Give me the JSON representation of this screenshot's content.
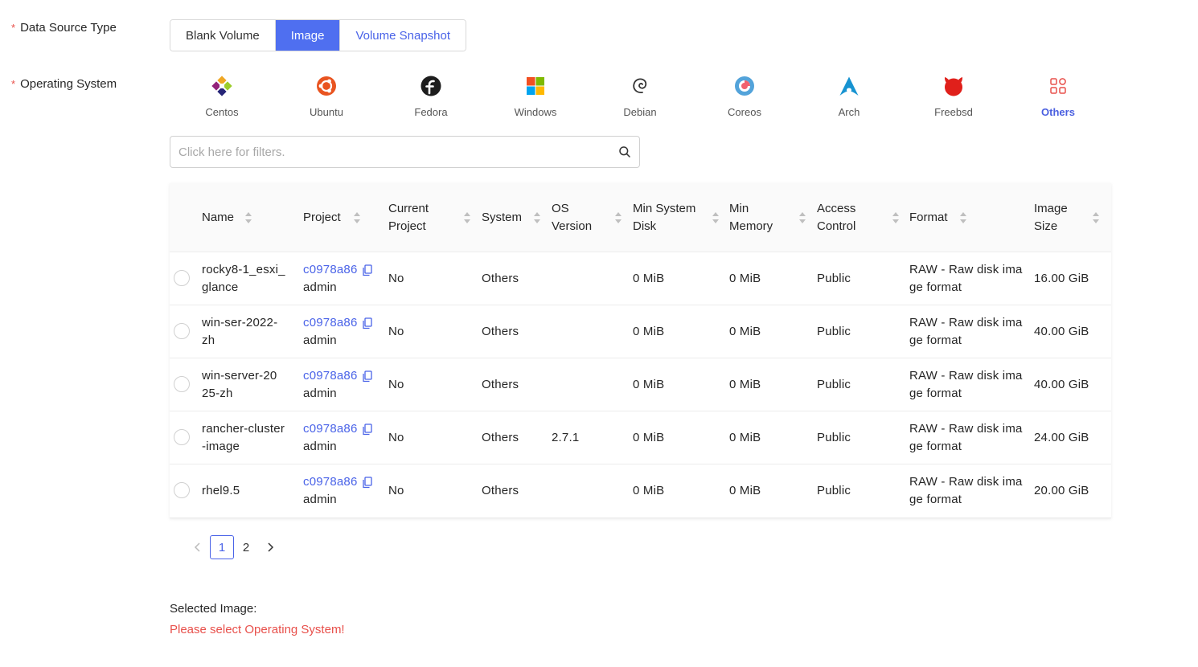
{
  "form": {
    "data_source_label": "Data Source Type",
    "os_label": "Operating System",
    "required_mark": "*"
  },
  "source_types": [
    {
      "label": "Blank Volume",
      "state": "normal"
    },
    {
      "label": "Image",
      "state": "active"
    },
    {
      "label": "Volume Snapshot",
      "state": "link"
    }
  ],
  "operating_systems": [
    {
      "label": "Centos",
      "icon": "centos-icon"
    },
    {
      "label": "Ubuntu",
      "icon": "ubuntu-icon"
    },
    {
      "label": "Fedora",
      "icon": "fedora-icon"
    },
    {
      "label": "Windows",
      "icon": "windows-icon"
    },
    {
      "label": "Debian",
      "icon": "debian-icon"
    },
    {
      "label": "Coreos",
      "icon": "coreos-icon"
    },
    {
      "label": "Arch",
      "icon": "arch-icon"
    },
    {
      "label": "Freebsd",
      "icon": "freebsd-icon"
    },
    {
      "label": "Others",
      "icon": "others-icon",
      "active": true
    }
  ],
  "filter": {
    "placeholder": "Click here for filters.",
    "value": ""
  },
  "table": {
    "columns": [
      {
        "key": "name",
        "line1": "Name",
        "line2": ""
      },
      {
        "key": "project",
        "line1": "Project",
        "line2": ""
      },
      {
        "key": "current_project",
        "line1": "Current",
        "line2": "Project"
      },
      {
        "key": "system",
        "line1": "System",
        "line2": ""
      },
      {
        "key": "os_version",
        "line1": "OS",
        "line2": "Version"
      },
      {
        "key": "min_disk",
        "line1": "Min System",
        "line2": "Disk"
      },
      {
        "key": "min_memory",
        "line1": "Min",
        "line2": "Memory"
      },
      {
        "key": "access",
        "line1": "Access",
        "line2": "Control"
      },
      {
        "key": "format",
        "line1": "Format",
        "line2": ""
      },
      {
        "key": "size",
        "line1": "Image",
        "line2": "Size"
      }
    ],
    "rows": [
      {
        "name1": "rocky8-1_esxi_",
        "name2": "glance",
        "project_id": "c0978a86",
        "project_name": "admin",
        "current_project": "No",
        "system": "Others",
        "os_version": "",
        "min_disk": "0 MiB",
        "min_memory": "0 MiB",
        "access": "Public",
        "format1": "RAW - Raw disk ima",
        "format2": "ge format",
        "size": "16.00 GiB"
      },
      {
        "name1": "win-ser-2022-",
        "name2": "zh",
        "project_id": "c0978a86",
        "project_name": "admin",
        "current_project": "No",
        "system": "Others",
        "os_version": "",
        "min_disk": "0 MiB",
        "min_memory": "0 MiB",
        "access": "Public",
        "format1": "RAW - Raw disk ima",
        "format2": "ge format",
        "size": "40.00 GiB"
      },
      {
        "name1": "win-server-20",
        "name2": "25-zh",
        "project_id": "c0978a86",
        "project_name": "admin",
        "current_project": "No",
        "system": "Others",
        "os_version": "",
        "min_disk": "0 MiB",
        "min_memory": "0 MiB",
        "access": "Public",
        "format1": "RAW - Raw disk ima",
        "format2": "ge format",
        "size": "40.00 GiB"
      },
      {
        "name1": "rancher-cluster",
        "name2": "-image",
        "project_id": "c0978a86",
        "project_name": "admin",
        "current_project": "No",
        "system": "Others",
        "os_version": "2.7.1",
        "min_disk": "0 MiB",
        "min_memory": "0 MiB",
        "access": "Public",
        "format1": "RAW - Raw disk ima",
        "format2": "ge format",
        "size": "24.00 GiB"
      },
      {
        "name1": "rhel9.5",
        "name2": "",
        "project_id": "c0978a86",
        "project_name": "admin",
        "current_project": "No",
        "system": "Others",
        "os_version": "",
        "min_disk": "0 MiB",
        "min_memory": "0 MiB",
        "access": "Public",
        "format1": "RAW - Raw disk ima",
        "format2": "ge format",
        "size": "20.00 GiB"
      }
    ]
  },
  "pagination": {
    "pages": [
      "1",
      "2"
    ],
    "current": "1"
  },
  "selection": {
    "label": "Selected Image:",
    "error": "Please select Operating System!"
  },
  "colors": {
    "accent": "#4f6ff0",
    "link": "#4a63e8",
    "error": "#e8504b"
  }
}
